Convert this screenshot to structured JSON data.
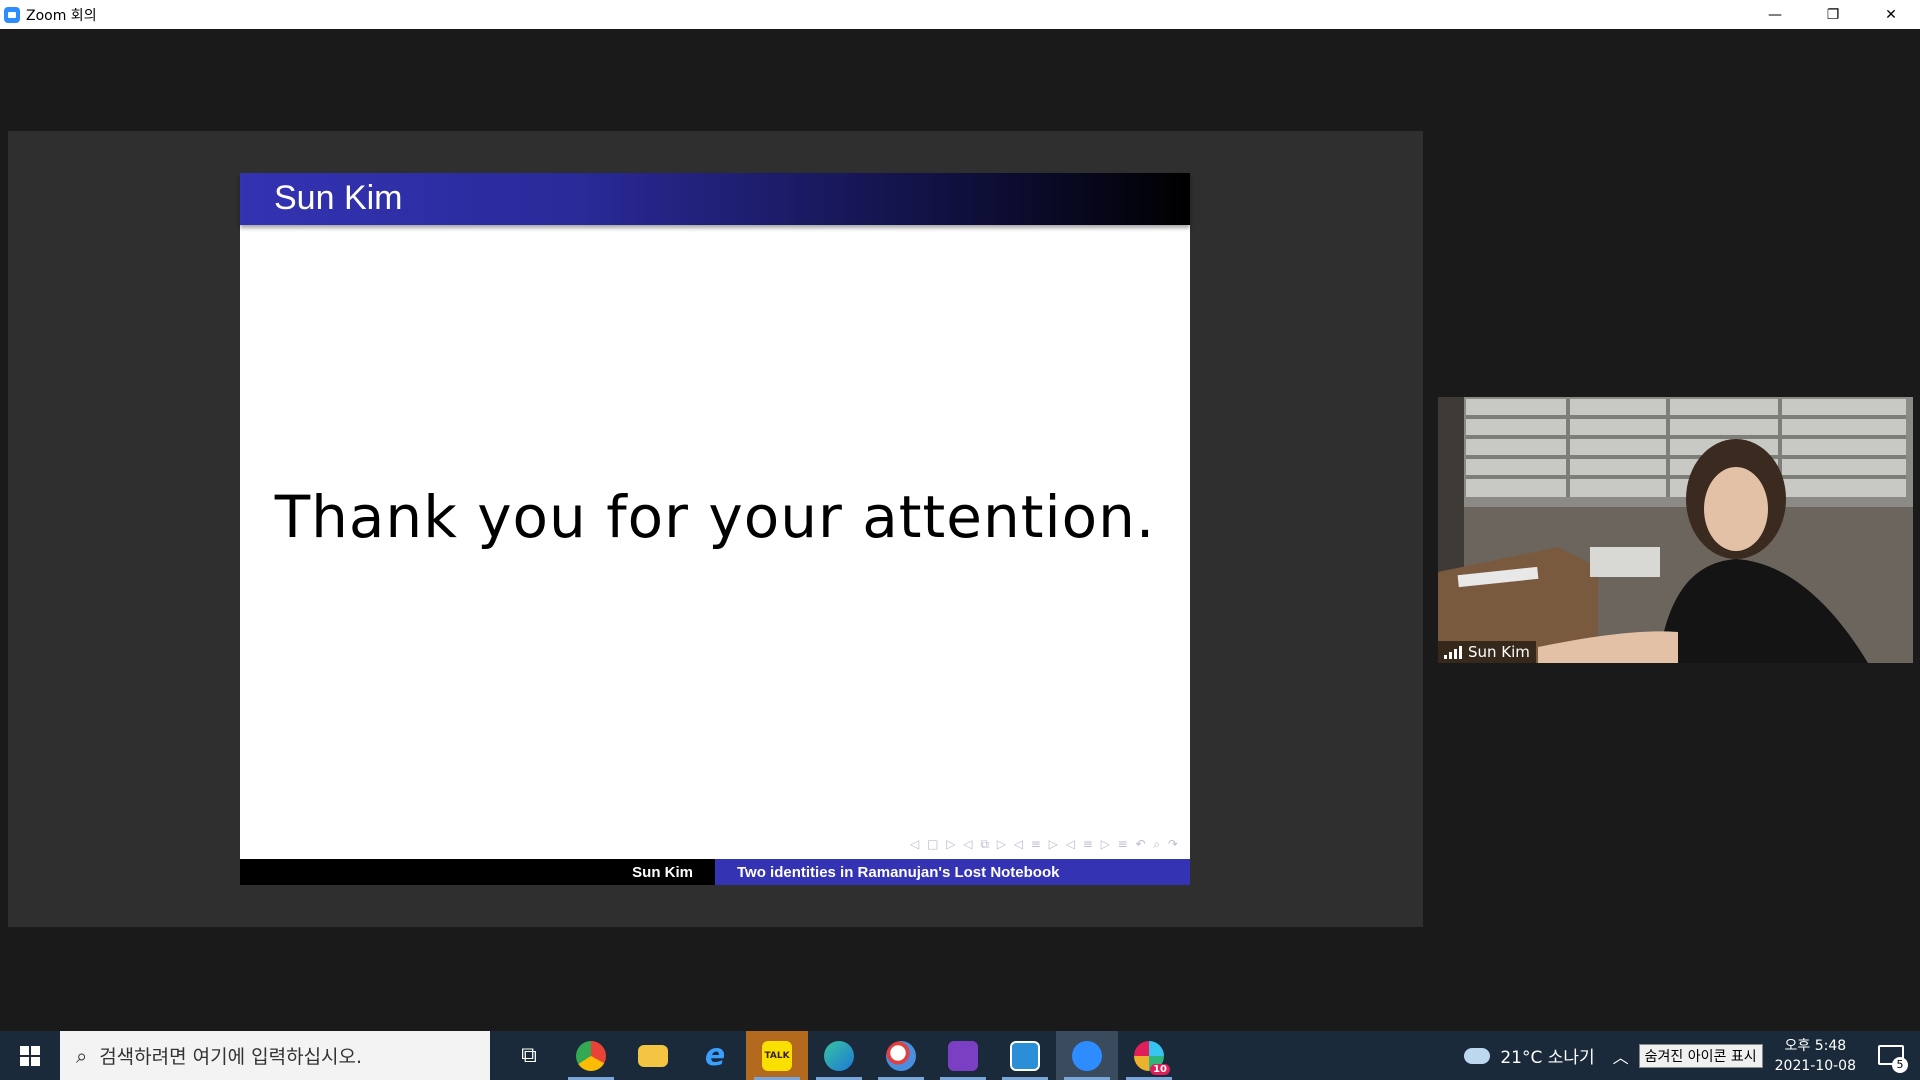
{
  "window": {
    "title": "Zoom 회의",
    "controls": {
      "minimize": "—",
      "maximize": "❐",
      "close": "✕"
    }
  },
  "slide": {
    "header_title": "Sun Kim",
    "body_text": "Thank you for your attention.",
    "nav_symbols": "◁ □ ▷  ◁ ⧉ ▷  ◁ ≡ ▷  ◁ ≡ ▷   ≡   ↶ ⌕ ↷",
    "footer_left": "Sun Kim",
    "footer_right": "Two identities in Ramanujan's Lost Notebook",
    "colors": {
      "header_start": "#3333b3",
      "header_end": "#000000",
      "footer_right_bg": "#3333b3"
    }
  },
  "video": {
    "participant_name": "Sun Kim"
  },
  "taskbar": {
    "search_placeholder": "검색하려면 여기에 입력하십시오.",
    "apps": [
      {
        "name": "task-view-icon",
        "label": "⧉"
      },
      {
        "name": "chrome-icon",
        "label": ""
      },
      {
        "name": "file-explorer-icon",
        "label": ""
      },
      {
        "name": "internet-explorer-icon",
        "label": "e"
      },
      {
        "name": "kakaotalk-icon",
        "label": "TALK"
      },
      {
        "name": "edge-icon",
        "label": ""
      },
      {
        "name": "paint-icon",
        "label": ""
      },
      {
        "name": "visual-studio-icon",
        "label": ""
      },
      {
        "name": "notepad-icon",
        "label": ""
      },
      {
        "name": "zoom-icon",
        "label": ""
      },
      {
        "name": "slack-icon",
        "label": "10"
      }
    ],
    "weather": "21°C  소나기",
    "tooltip": "숨겨진 아이콘 표시",
    "time": "오후 5:48",
    "date": "2021-10-08",
    "notification_count": "5"
  }
}
